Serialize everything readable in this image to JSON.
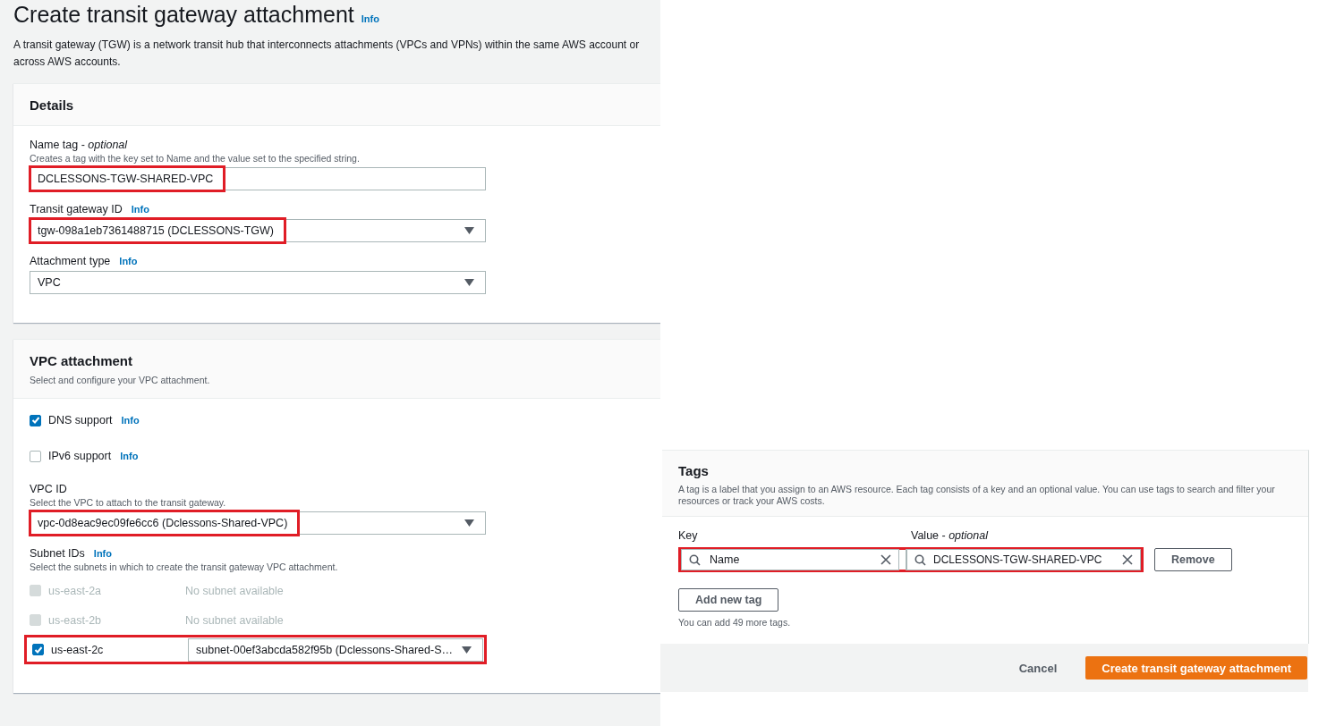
{
  "page": {
    "title": "Create transit gateway attachment",
    "info_link": "Info",
    "description": "A transit gateway (TGW) is a network transit hub that interconnects attachments (VPCs and VPNs) within the same AWS account or across AWS accounts."
  },
  "details": {
    "heading": "Details",
    "fields": [
      {
        "kind": "text",
        "label": "Name tag - *optional*",
        "hint": "Creates a tag with the key set to Name and the value set to the specified string.",
        "value": "DCLESSONS-TGW-SHARED-VPC",
        "highlighted": true
      },
      {
        "kind": "select",
        "label": "Transit gateway ID",
        "info_link": "Info",
        "value": "tgw-098a1eb7361488715 (DCLESSONS-TGW)",
        "highlighted": true
      },
      {
        "kind": "select",
        "label": "Attachment type",
        "info_link": "Info",
        "value": "VPC",
        "highlighted": false
      }
    ]
  },
  "vpc_attachment": {
    "heading": "VPC attachment",
    "description": "Select and configure your VPC attachment.",
    "options": [
      {
        "label": "DNS support",
        "info_link": "Info",
        "checked": true
      },
      {
        "label": "IPv6 support",
        "info_link": "Info",
        "checked": false
      }
    ],
    "vpc_id": {
      "label": "VPC ID",
      "hint": "Select the VPC to attach to the transit gateway.",
      "value": "vpc-0d8eac9ec09fe6cc6 (Dclessons-Shared-VPC)",
      "highlighted": true
    },
    "subnets": {
      "label": "Subnet IDs",
      "info_link": "Info",
      "hint": "Select the subnets in which to create the transit gateway VPC attachment.",
      "rows": [
        {
          "zone": "us-east-2a",
          "checked": false,
          "disabled": true,
          "status": "No subnet available",
          "highlighted": false
        },
        {
          "zone": "us-east-2b",
          "checked": false,
          "disabled": true,
          "status": "No subnet available",
          "highlighted": false
        },
        {
          "zone": "us-east-2c",
          "checked": true,
          "disabled": false,
          "value": "subnet-00ef3abcda582f95b (Dclessons-Shared-S…",
          "highlighted": true
        }
      ]
    }
  },
  "tags": {
    "heading": "Tags",
    "description": "A tag is a label that you assign to an AWS resource. Each tag consists of a key and an optional value. You can use tags to search and filter your resources or track your AWS costs.",
    "key_label": "Key",
    "value_label": "Value - *optional*",
    "rows": [
      {
        "key": "Name",
        "value": "DCLESSONS-TGW-SHARED-VPC",
        "highlighted": true
      }
    ],
    "remove_button": "Remove",
    "add_button": "Add new tag",
    "limit_note": "You can add 49 more tags."
  },
  "footer": {
    "cancel": "Cancel",
    "submit": "Create transit gateway attachment"
  }
}
